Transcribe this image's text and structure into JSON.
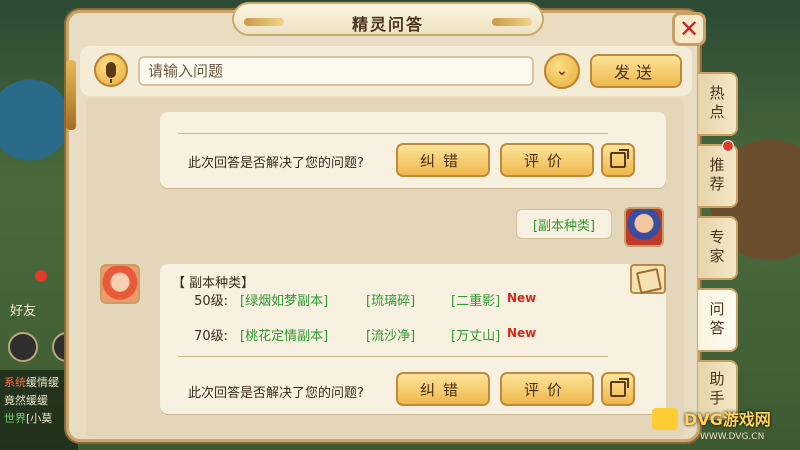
{
  "dialog": {
    "title": "精灵问答",
    "close_label": "✕"
  },
  "search": {
    "placeholder": "请输入问题",
    "send_label": "发送"
  },
  "side_tabs": [
    {
      "label": "热点",
      "active": false,
      "badge": false
    },
    {
      "label": "推荐",
      "active": false,
      "badge": true
    },
    {
      "label": "专家",
      "active": false,
      "badge": false
    },
    {
      "label": "问答",
      "active": true,
      "badge": false
    },
    {
      "label": "助手",
      "active": false,
      "badge": false
    }
  ],
  "feedback": {
    "question": "此次回答是否解决了您的问题?",
    "correct_label": "纠错",
    "rate_label": "评价"
  },
  "user_message": {
    "text": "[副本种类]"
  },
  "answer": {
    "title": "【 副本种类】",
    "rows": [
      {
        "level": "50级:",
        "links": [
          "[绿烟如梦副本]",
          "[琉璃碎]",
          "[二重影]"
        ],
        "new_tag": "New"
      },
      {
        "level": "70级:",
        "links": [
          "[桃花定情副本]",
          "[流沙净]",
          "[万丈山]"
        ],
        "new_tag": "New"
      }
    ]
  },
  "background": {
    "friend_label": "好友",
    "chat_lines": [
      {
        "tag": "系统",
        "text": "缓情缓"
      },
      {
        "tag": "",
        "text": "竟然缓缓"
      },
      {
        "tag": "世界",
        "text": "[小莫"
      }
    ]
  },
  "watermark": {
    "brand": "DVG游戏网",
    "url": "WWW.DVG.CN"
  },
  "colors": {
    "panel_bg": "#e8dcc3",
    "gold_button": "#efb84c",
    "link_green": "#2f9a2f",
    "new_red": "#d12a1a",
    "close_red": "#c72222"
  },
  "icons": {
    "voice": "microphone-icon",
    "dropdown": "chevron-down-icon",
    "share": "share-icon",
    "close": "close-icon",
    "book": "book-icon"
  }
}
